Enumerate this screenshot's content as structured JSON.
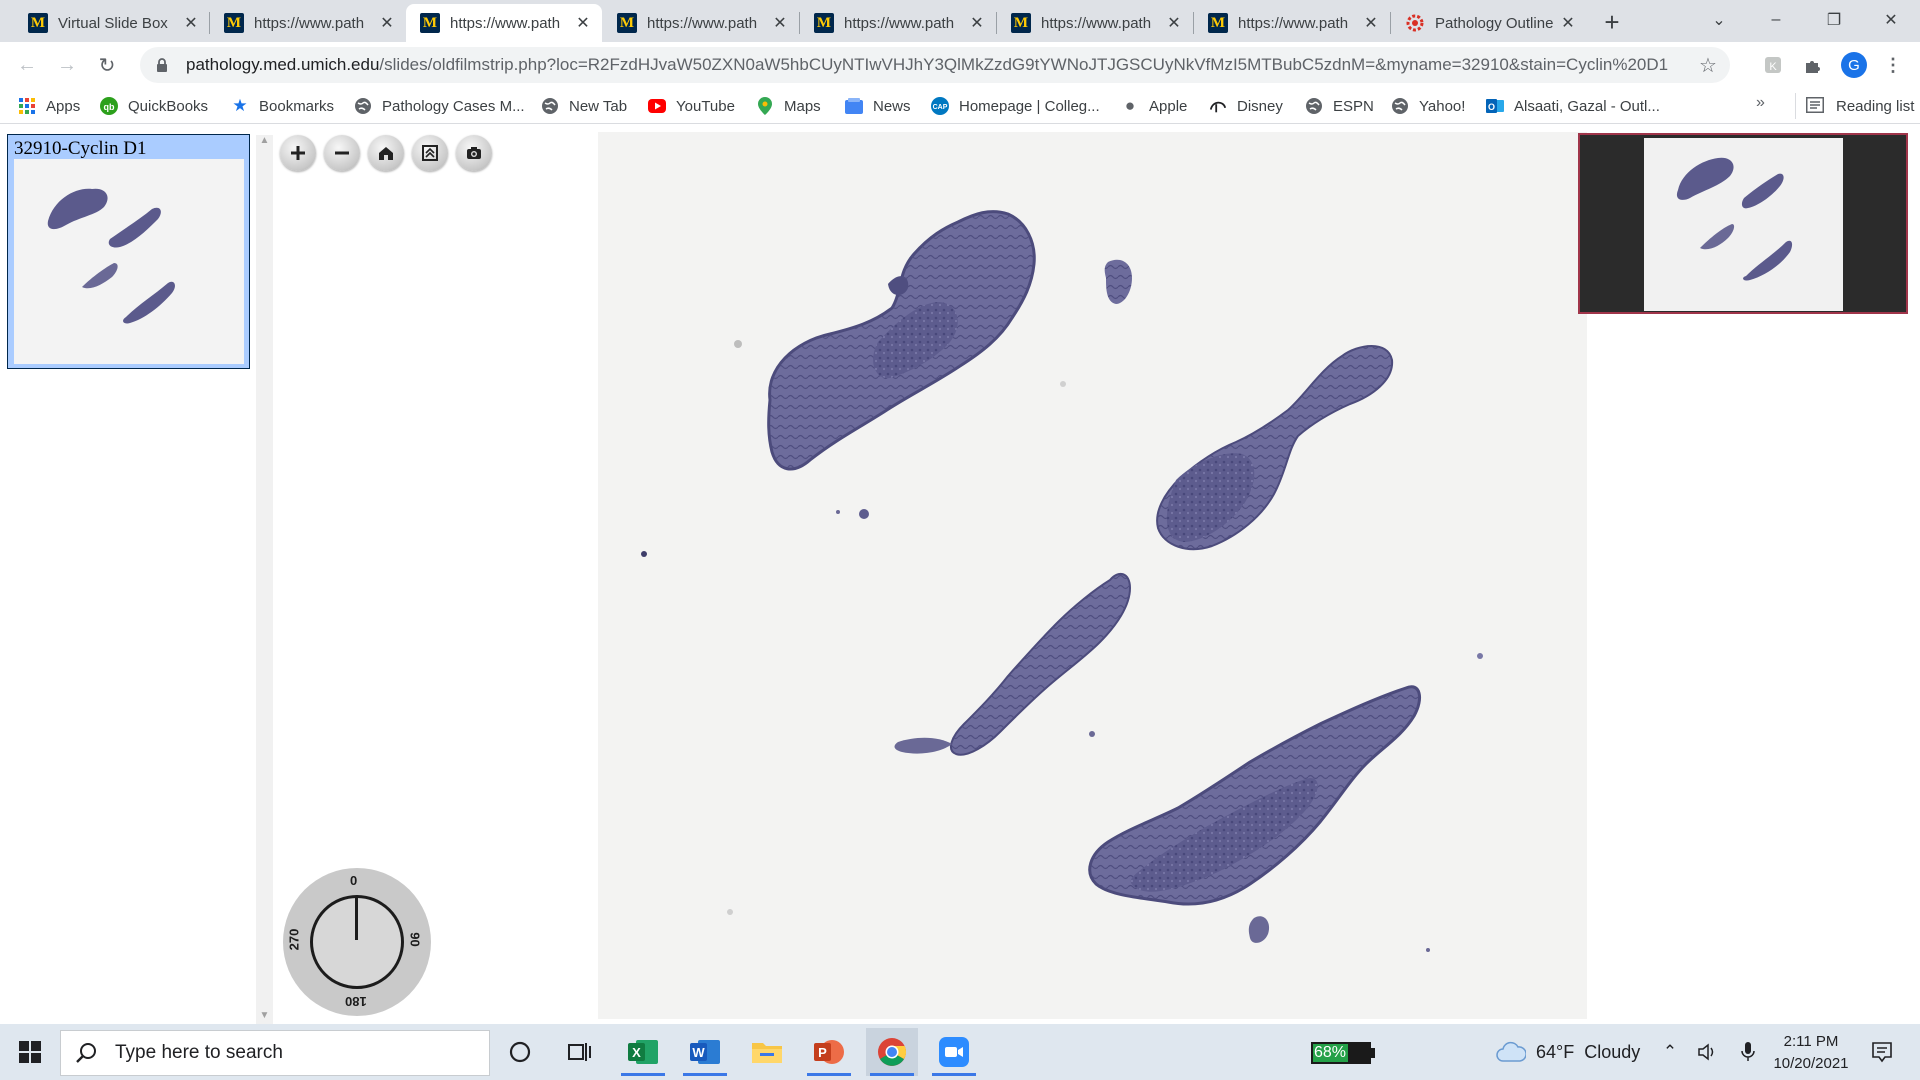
{
  "browser": {
    "tabs": [
      {
        "title": "Virtual Slide Box",
        "favicon": "umich-m-icon",
        "active": false
      },
      {
        "title": "https://www.path",
        "favicon": "umich-m-icon",
        "active": false
      },
      {
        "title": "https://www.path",
        "favicon": "umich-m-icon",
        "active": true
      },
      {
        "title": "https://www.path",
        "favicon": "umich-m-icon",
        "active": false
      },
      {
        "title": "https://www.path",
        "favicon": "umich-m-icon",
        "active": false
      },
      {
        "title": "https://www.path",
        "favicon": "umich-m-icon",
        "active": false
      },
      {
        "title": "https://www.path",
        "favicon": "umich-m-icon",
        "active": false
      },
      {
        "title": "Pathology Outline",
        "favicon": "gear-icon",
        "active": false
      }
    ],
    "url_host": "pathology.med.umich.edu",
    "url_path": "/slides/oldfilmstrip.php?loc=R2FzdHJvaW50ZXN0aW5hbCUyNTIwVHJhY3QlMkZzdG9tYWNoJTJGSCUyNkVfMzI5MTBubC5zdnM=&myname=32910&stain=Cyclin%20D1",
    "profile_initial": "G",
    "bookmarks": [
      {
        "label": "Apps",
        "icon": "apps-grid-icon"
      },
      {
        "label": "QuickBooks",
        "icon": "quickbooks-icon"
      },
      {
        "label": "Bookmarks",
        "icon": "star-icon"
      },
      {
        "label": "Pathology Cases M...",
        "icon": "globe-icon"
      },
      {
        "label": "New Tab",
        "icon": "globe-icon"
      },
      {
        "label": "YouTube",
        "icon": "youtube-icon"
      },
      {
        "label": "Maps",
        "icon": "maps-pin-icon"
      },
      {
        "label": "News",
        "icon": "news-icon"
      },
      {
        "label": "Homepage | Colleg...",
        "icon": "cap-icon"
      },
      {
        "label": "Apple",
        "icon": "apple-icon"
      },
      {
        "label": "Disney",
        "icon": "disney-icon"
      },
      {
        "label": "ESPN",
        "icon": "globe-icon"
      },
      {
        "label": "Yahoo!",
        "icon": "globe-icon"
      },
      {
        "label": "Alsaati, Gazal - Outl...",
        "icon": "outlook-icon"
      }
    ],
    "bookmarks_overflow": "»",
    "reading_list": "Reading list"
  },
  "viewer": {
    "thumbnail_label": "32910-Cyclin D1",
    "tools": [
      {
        "name": "zoom-in-button",
        "icon": "plus-icon"
      },
      {
        "name": "zoom-out-button",
        "icon": "minus-icon"
      },
      {
        "name": "home-button",
        "icon": "home-icon"
      },
      {
        "name": "fullscreen-button",
        "icon": "fullscreen-icon"
      },
      {
        "name": "screenshot-button",
        "icon": "camera-icon"
      }
    ],
    "rotation": {
      "top": "0",
      "right": "90",
      "bottom": "180",
      "left": "270"
    }
  },
  "taskbar": {
    "search_placeholder": "Type here to search",
    "battery_percent": "68%",
    "battery_level": 0.68,
    "weather": "64°F  Cloudy",
    "time": "2:11 PM",
    "date": "10/20/2021"
  },
  "colors": {
    "thumbnail_bg": "#aaccff",
    "tissue": "#5b5a8c",
    "navigator_border": "#a0354a",
    "taskbar_bg": "#dfe7ef"
  }
}
